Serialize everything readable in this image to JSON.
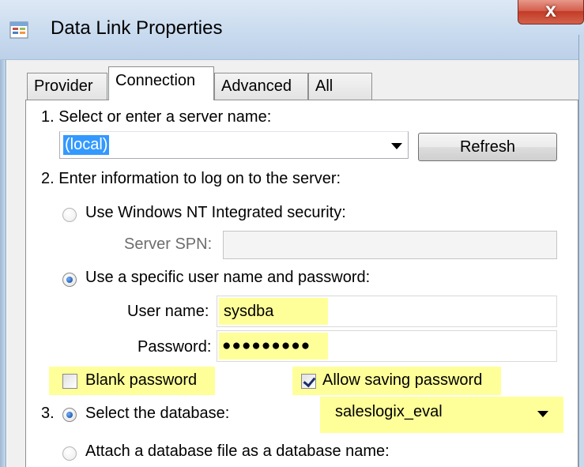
{
  "window": {
    "title": "Data Link Properties",
    "close_glyph": "x",
    "icon": "data-link-icon"
  },
  "tabs": [
    {
      "label": "Provider",
      "active": false
    },
    {
      "label": "Connection",
      "active": true
    },
    {
      "label": "Advanced",
      "active": false
    },
    {
      "label": "All",
      "active": false
    }
  ],
  "step1": {
    "label": "1. Select or enter a server name:",
    "server_value": "(local)",
    "refresh_label": "Refresh"
  },
  "step2": {
    "label": "2. Enter information to log on to the server:",
    "windows_nt_label": "Use Windows NT Integrated security:",
    "windows_nt_checked": false,
    "server_spn_label": "Server SPN:",
    "server_spn_value": "",
    "specific_user_label": "Use a specific user name and password:",
    "specific_user_checked": true,
    "user_name_label": "User name:",
    "user_name_value": "sysdba",
    "password_label": "Password:",
    "password_masked": "●●●●●●●●●",
    "blank_password_label": "Blank password",
    "blank_password_checked": false,
    "allow_saving_label": "Allow saving password",
    "allow_saving_checked": true
  },
  "step3": {
    "number": "3.",
    "select_db_label": "Select the database:",
    "select_db_checked": true,
    "database_value": "saleslogix_eval",
    "attach_label": "Attach a database file as a database name:",
    "attach_checked": false
  },
  "colors": {
    "highlight": "#ffff99",
    "selection": "#3399ff",
    "title_bar": "#c9dbef",
    "close_button": "#c94a36"
  }
}
